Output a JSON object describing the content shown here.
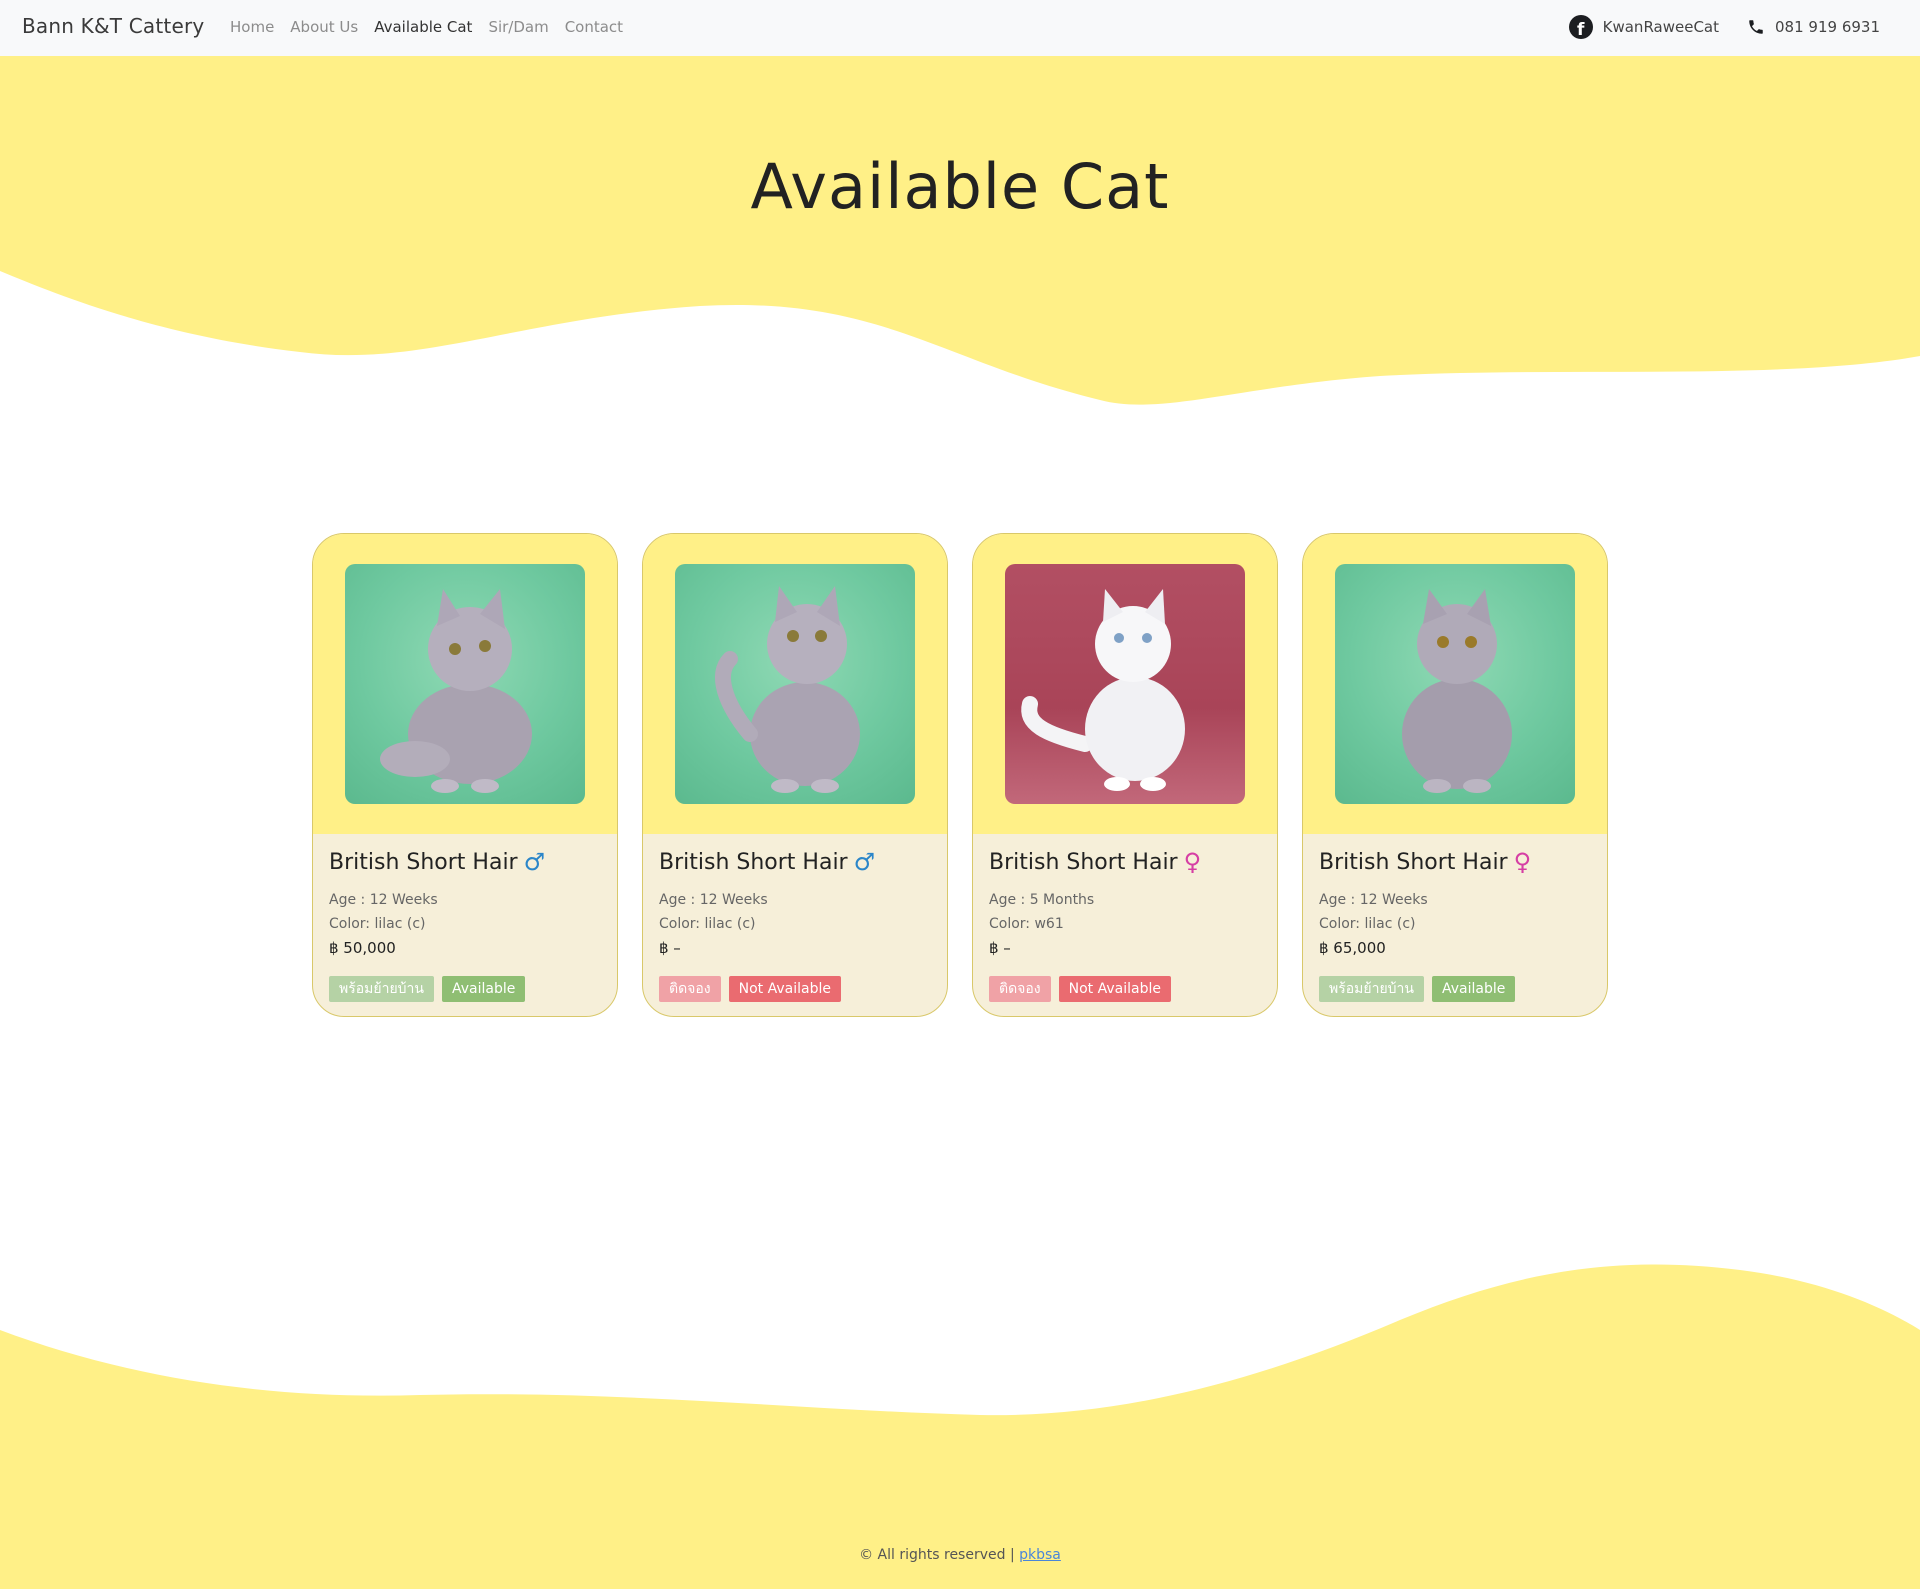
{
  "nav": {
    "brand": "Bann K&T Cattery",
    "links": [
      "Home",
      "About Us",
      "Available Cat",
      "Sir/Dam",
      "Contact"
    ],
    "facebook": "KwanRaweeCat",
    "phone": "081 919 6931"
  },
  "hero": {
    "title": "Available Cat"
  },
  "colors": {
    "yellow": "#fff087",
    "card_body": "#f6efd9",
    "available": "#8fbe73",
    "not_available": "#ea6b70"
  },
  "cats": [
    {
      "breed": "British Short Hair",
      "sex_symbol": "♂",
      "age": "Age : 12 Weeks",
      "color": "Color: lilac (c)",
      "price": "฿ 50,000",
      "status_th": "พร้อมย้ายบ้าน",
      "status_en": "Available"
    },
    {
      "breed": "British Short Hair",
      "sex_symbol": "♂",
      "age": "Age : 12 Weeks",
      "color": "Color: lilac (c)",
      "price": "฿ –",
      "status_th": "ติดจอง",
      "status_en": "Not Available"
    },
    {
      "breed": "British Short Hair",
      "sex_symbol": "♀",
      "age": "Age : 5 Months",
      "color": "Color: w61",
      "price": "฿ –",
      "status_th": "ติดจอง",
      "status_en": "Not Available"
    },
    {
      "breed": "British Short Hair",
      "sex_symbol": "♀",
      "age": "Age : 12 Weeks",
      "color": "Color: lilac (c)",
      "price": "฿ 65,000",
      "status_th": "พร้อมย้ายบ้าน",
      "status_en": "Available"
    }
  ],
  "footer": {
    "text": "© All rights reserved | ",
    "link": "pkbsa"
  }
}
